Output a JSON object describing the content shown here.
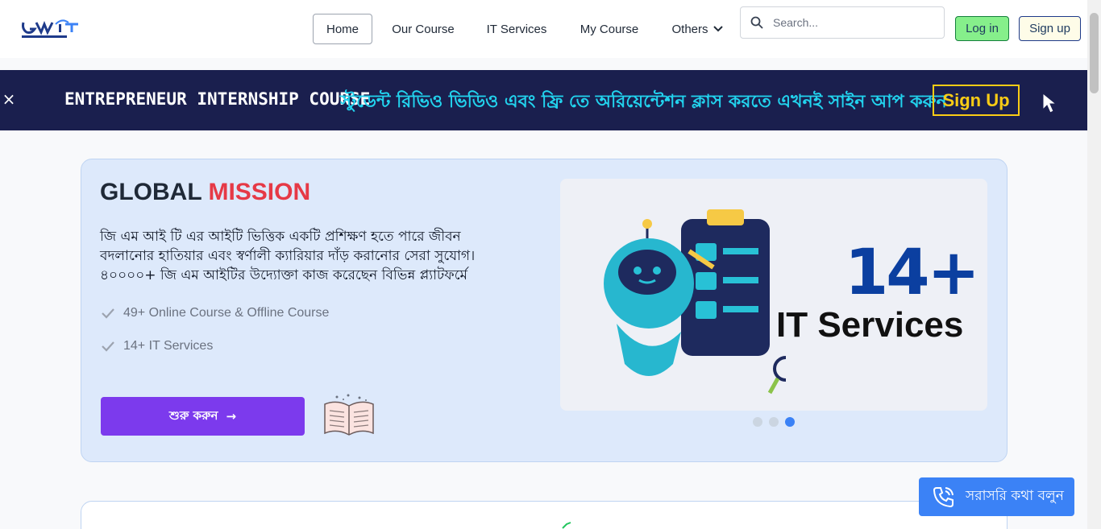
{
  "header": {
    "logo_alt": "GMIT global mission",
    "nav": [
      {
        "label": "Home"
      },
      {
        "label": "Our Course"
      },
      {
        "label": "IT Services"
      },
      {
        "label": "My Course"
      },
      {
        "label": "Others"
      }
    ],
    "search_placeholder": "Search...",
    "login_label": "Log in",
    "signup_label": "Sign up"
  },
  "promo": {
    "close": "×",
    "title": "ENTREPRENEUR INTERNSHIP COURSE",
    "text": "স্টুডেন্ট রিভিও ভিডিও এবং ফ্রি তে অরিয়েন্টেশন ক্লাস করতে এখনই সাইন আপ করুন",
    "signup_label": "Sign Up"
  },
  "hero": {
    "title_part1": "GLOBAL ",
    "title_part2": "MISSION",
    "description": "জি এম আই টি এর আইটি ভিত্তিক একটি প্রশিক্ষণ হতে পারে জীবন বদলানোর হাতিয়ার এবং স্বর্ণালী ক্যারিয়ার দাঁড় করানোর সেরা সুযোগ। ৪০০০০+ জি এম আইটির উদ্যোক্তা কাজ করেছেন বিভিন্ন প্ল্যাটফর্মে",
    "features": [
      {
        "label": "49+ Online Course & Offline Course"
      },
      {
        "label": "14+ IT Services"
      }
    ],
    "cta_label": "শুরু করুন",
    "cta_arrow": "→",
    "slide": {
      "big_text": "14+",
      "sub_text": "IT Services"
    },
    "carousel": {
      "count": 3,
      "active_index": 2
    }
  },
  "call_button": {
    "label": "সরাসরি কথা বলুন"
  },
  "colors": {
    "accent_red": "#e63946",
    "promo_bg": "#1a1f4e",
    "promo_cyan": "#22d3ee",
    "promo_yellow": "#facc15",
    "cta_purple": "#7c3aed",
    "call_blue": "#3b82f6",
    "login_green": "#86ef8b"
  }
}
